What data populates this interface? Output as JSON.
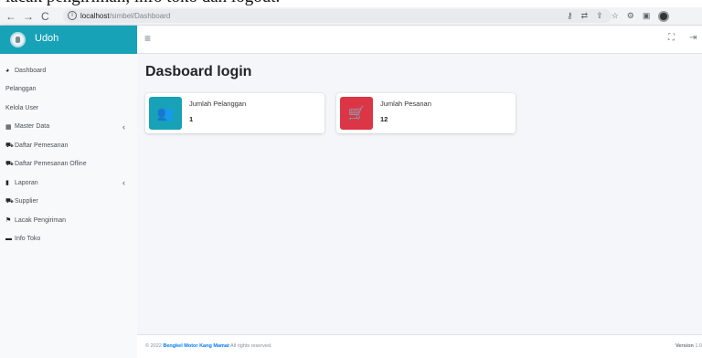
{
  "top_text": "lacak pengiriman, info toko dan logout.",
  "browser": {
    "back": "←",
    "forward": "→",
    "reload": "C",
    "url_host": "localhost",
    "url_path": "/simbel/Dashboard",
    "toolbar_icons": [
      "key-icon",
      "translate-icon",
      "share-icon",
      "star-icon",
      "extensions-icon",
      "sidebar-icon",
      "profile-icon"
    ]
  },
  "brand": {
    "name": "Udoh"
  },
  "sidebar": {
    "items": [
      {
        "label": "Dashboard",
        "icon": "tachometer-icon",
        "glyph": "◕"
      },
      {
        "label": "Pelanggan",
        "icon": "",
        "glyph": ""
      },
      {
        "label": "Kelola User",
        "icon": "",
        "glyph": ""
      },
      {
        "label": "Master Data",
        "icon": "table-icon",
        "glyph": "▦",
        "chevron": "‹"
      },
      {
        "label": "Daftar Pemesanan",
        "icon": "cart-icon",
        "glyph": "⛟"
      },
      {
        "label": "Daftar Pemesanan Ofline",
        "icon": "cart-icon",
        "glyph": "⛟"
      },
      {
        "label": "Laporan",
        "icon": "file-icon",
        "glyph": "▮",
        "chevron": "‹"
      },
      {
        "label": "Supplier",
        "icon": "truck-icon",
        "glyph": "⛟"
      },
      {
        "label": "Lacak Pengiriman",
        "icon": "shipping-icon",
        "glyph": "⚑"
      },
      {
        "label": "Info Toko",
        "icon": "store-icon",
        "glyph": "▬"
      }
    ]
  },
  "navbar": {
    "hamburger": "≡",
    "expand": "⛶",
    "logout": "⇥"
  },
  "page": {
    "title": "Dasboard login"
  },
  "boxes": [
    {
      "label": "Jumlah Pelanggan",
      "value": "1",
      "icon": "users-icon",
      "glyph": "👥",
      "color": "#17a2b8"
    },
    {
      "label": "Jumlah Pesanan",
      "value": "12",
      "icon": "shopping-cart-icon",
      "glyph": "🛒",
      "color": "#dc3545"
    }
  ],
  "footer": {
    "copy_prefix": "© 2022 ",
    "brand": "Bengkel Motor Kang Mamat",
    "suffix": " All rights reserved.",
    "version_label": "Version",
    "version_value": " 1.0"
  },
  "colors": {
    "accent": "#17a2b8",
    "danger": "#dc3545",
    "content_bg": "#f4f6f9"
  }
}
